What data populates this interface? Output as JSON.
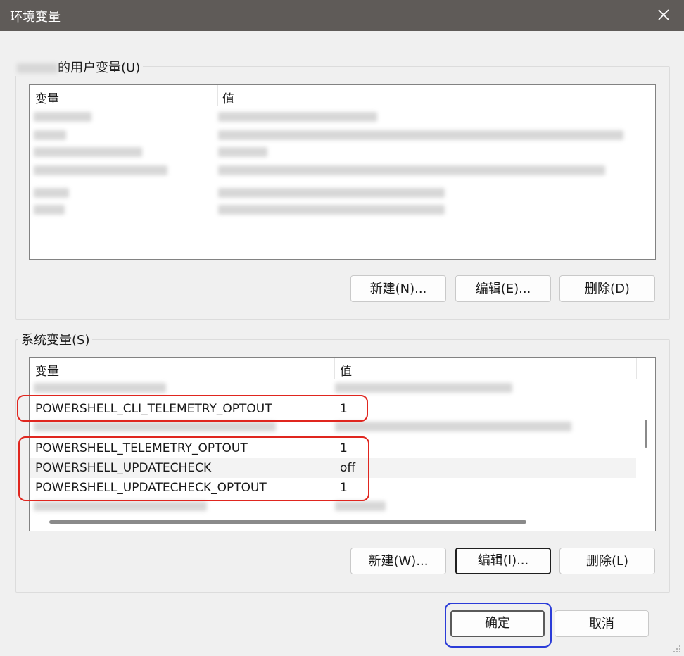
{
  "window": {
    "title": "环境变量"
  },
  "user_vars": {
    "label": "的用户变量(U)",
    "col_name": "变量",
    "col_value": "值",
    "buttons": {
      "new": "新建(N)...",
      "edit": "编辑(E)...",
      "delete": "删除(D)"
    }
  },
  "system_vars": {
    "label": "系统变量(S)",
    "col_name": "变量",
    "col_value": "值",
    "rows": [
      {
        "name": "POWERSHELL_CLI_TELEMETRY_OPTOUT",
        "value": "1"
      },
      {
        "name": "POWERSHELL_TELEMETRY_OPTOUT",
        "value": "1"
      },
      {
        "name": "POWERSHELL_UPDATECHECK",
        "value": "off"
      },
      {
        "name": "POWERSHELL_UPDATECHECK_OPTOUT",
        "value": "1"
      }
    ],
    "buttons": {
      "new": "新建(W)...",
      "edit": "编辑(I)...",
      "delete": "删除(L)"
    }
  },
  "footer": {
    "ok": "确定",
    "cancel": "取消"
  },
  "colors": {
    "titlebar": "#5f5b58",
    "highlight_red": "#e0261f",
    "highlight_blue": "#2b3cd8"
  }
}
